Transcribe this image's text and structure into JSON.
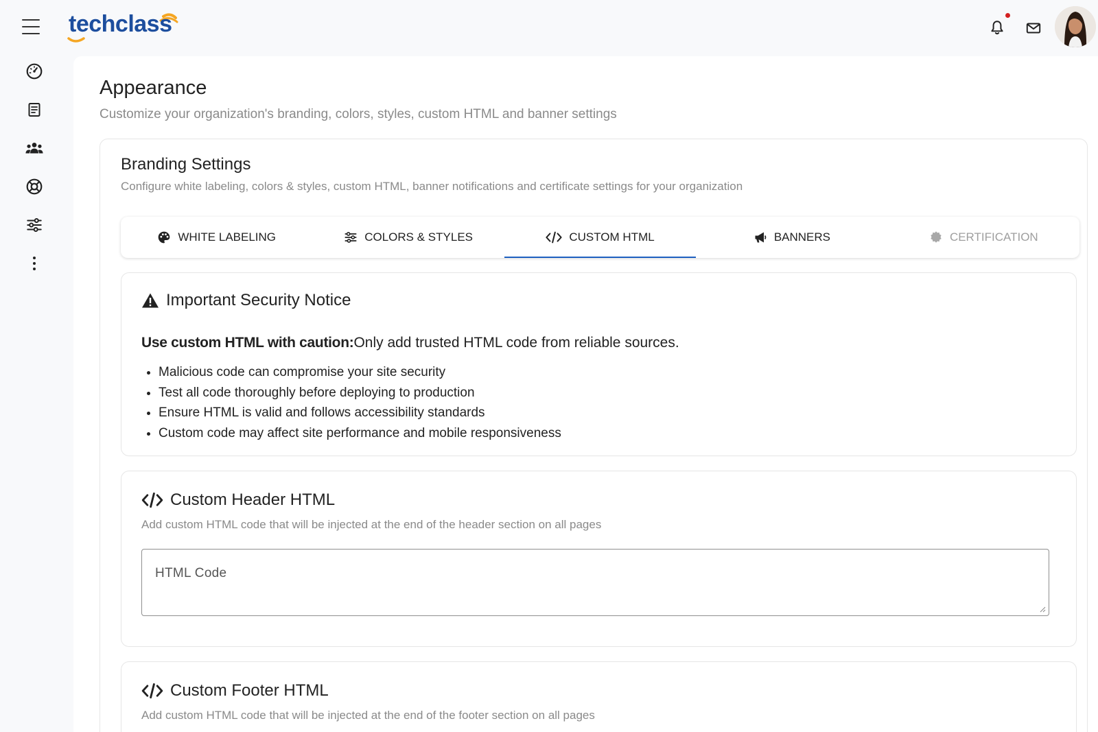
{
  "app": {
    "logo_text": "techclass"
  },
  "header": {
    "icons": [
      "menu-icon",
      "bell-icon",
      "mail-icon",
      "avatar"
    ]
  },
  "sidebar": {
    "icons": [
      "dashboard-icon",
      "book-icon",
      "users-icon",
      "support-icon",
      "sliders-icon",
      "more-vertical-icon"
    ]
  },
  "page": {
    "title": "Appearance",
    "subtitle": "Customize your organization's branding, colors, styles, custom HTML and banner settings"
  },
  "branding": {
    "title": "Branding Settings",
    "subtitle": "Configure white labeling, colors & styles, custom HTML, banner notifications and certificate settings for your organization"
  },
  "tabs": [
    {
      "label": "WHITE LABELING",
      "icon": "palette-icon",
      "active": false,
      "disabled": false
    },
    {
      "label": "COLORS & STYLES",
      "icon": "sliders-icon",
      "active": false,
      "disabled": false
    },
    {
      "label": "CUSTOM HTML",
      "icon": "code-icon",
      "active": true,
      "disabled": false
    },
    {
      "label": "BANNERS",
      "icon": "megaphone-icon",
      "active": false,
      "disabled": false
    },
    {
      "label": "CERTIFICATION",
      "icon": "badge-icon",
      "active": false,
      "disabled": true
    }
  ],
  "notice": {
    "title": "Important Security Notice",
    "lead_bold": "Use custom HTML with caution:",
    "lead_rest": "Only add trusted HTML code from reliable sources.",
    "items": [
      "Malicious code can compromise your site security",
      "Test all code thoroughly before deploying to production",
      "Ensure HTML is valid and follows accessibility standards",
      "Custom code may affect site performance and mobile responsiveness"
    ]
  },
  "header_html": {
    "title": "Custom Header HTML",
    "subtitle": "Add custom HTML code that will be injected at the end of the header section on all pages",
    "placeholder": "HTML Code"
  },
  "footer_html": {
    "title": "Custom Footer HTML",
    "subtitle": "Add custom HTML code that will be injected at the end of the footer section on all pages"
  },
  "colors": {
    "brand_blue": "#1d4e9e",
    "brand_orange": "#f5a623",
    "active_tab_underline": "#1d5fbf",
    "notification_dot": "#d32020"
  }
}
